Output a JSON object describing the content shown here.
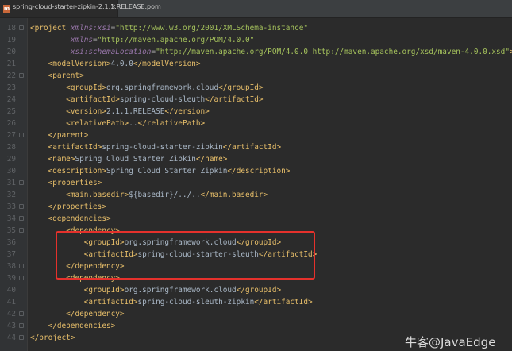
{
  "tab": {
    "icon_letter": "m",
    "title": "spring-cloud-starter-zipkin-2.1.1.RELEASE.pom",
    "close": "×"
  },
  "lines": [
    {
      "num": "18",
      "fold": true,
      "tokens": [
        {
          "c": "b",
          "t": "<"
        },
        {
          "c": "tg",
          "t": "project "
        },
        {
          "c": "ns",
          "t": "xmlns:xsi"
        },
        {
          "c": "at",
          "t": "="
        },
        {
          "c": "av",
          "t": "\"http://www.w3.org/2001/XMLSchema-instance\""
        }
      ]
    },
    {
      "num": "19",
      "fold": false,
      "tokens": [
        {
          "c": "tx",
          "t": "         "
        },
        {
          "c": "ns",
          "t": "xmlns"
        },
        {
          "c": "at",
          "t": "="
        },
        {
          "c": "av",
          "t": "\"http://maven.apache.org/POM/4.0.0\""
        }
      ]
    },
    {
      "num": "20",
      "fold": false,
      "tokens": [
        {
          "c": "tx",
          "t": "         "
        },
        {
          "c": "ns",
          "t": "xsi:schemaLocation"
        },
        {
          "c": "at",
          "t": "="
        },
        {
          "c": "av",
          "t": "\"http://maven.apache.org/POM/4.0.0 http://maven.apache.org/xsd/maven-4.0.0.xsd\""
        },
        {
          "c": "b",
          "t": ">"
        }
      ]
    },
    {
      "num": "21",
      "fold": false,
      "tokens": [
        {
          "c": "tx",
          "t": "    "
        },
        {
          "c": "b",
          "t": "<"
        },
        {
          "c": "tg",
          "t": "modelVersion"
        },
        {
          "c": "b",
          "t": ">"
        },
        {
          "c": "tx",
          "t": "4.0.0"
        },
        {
          "c": "b",
          "t": "</"
        },
        {
          "c": "tg",
          "t": "modelVersion"
        },
        {
          "c": "b",
          "t": ">"
        }
      ]
    },
    {
      "num": "22",
      "fold": true,
      "tokens": [
        {
          "c": "tx",
          "t": "    "
        },
        {
          "c": "b",
          "t": "<"
        },
        {
          "c": "tg",
          "t": "parent"
        },
        {
          "c": "b",
          "t": ">"
        }
      ]
    },
    {
      "num": "23",
      "fold": false,
      "tokens": [
        {
          "c": "tx",
          "t": "        "
        },
        {
          "c": "b",
          "t": "<"
        },
        {
          "c": "tg",
          "t": "groupId"
        },
        {
          "c": "b",
          "t": ">"
        },
        {
          "c": "tx",
          "t": "org.springframework.cloud"
        },
        {
          "c": "b",
          "t": "</"
        },
        {
          "c": "tg",
          "t": "groupId"
        },
        {
          "c": "b",
          "t": ">"
        }
      ]
    },
    {
      "num": "24",
      "fold": false,
      "tokens": [
        {
          "c": "tx",
          "t": "        "
        },
        {
          "c": "b",
          "t": "<"
        },
        {
          "c": "tg",
          "t": "artifactId"
        },
        {
          "c": "b",
          "t": ">"
        },
        {
          "c": "tx",
          "t": "spring-cloud-sleuth"
        },
        {
          "c": "b",
          "t": "</"
        },
        {
          "c": "tg",
          "t": "artifactId"
        },
        {
          "c": "b",
          "t": ">"
        }
      ]
    },
    {
      "num": "25",
      "fold": false,
      "tokens": [
        {
          "c": "tx",
          "t": "        "
        },
        {
          "c": "b",
          "t": "<"
        },
        {
          "c": "tg",
          "t": "version"
        },
        {
          "c": "b",
          "t": ">"
        },
        {
          "c": "tx",
          "t": "2.1.1.RELEASE"
        },
        {
          "c": "b",
          "t": "</"
        },
        {
          "c": "tg",
          "t": "version"
        },
        {
          "c": "b",
          "t": ">"
        }
      ]
    },
    {
      "num": "26",
      "fold": false,
      "tokens": [
        {
          "c": "tx",
          "t": "        "
        },
        {
          "c": "b",
          "t": "<"
        },
        {
          "c": "tg",
          "t": "relativePath"
        },
        {
          "c": "b",
          "t": ">"
        },
        {
          "c": "tx",
          "t": ".."
        },
        {
          "c": "b",
          "t": "</"
        },
        {
          "c": "tg",
          "t": "relativePath"
        },
        {
          "c": "b",
          "t": ">"
        }
      ]
    },
    {
      "num": "27",
      "fold": true,
      "tokens": [
        {
          "c": "tx",
          "t": "    "
        },
        {
          "c": "b",
          "t": "</"
        },
        {
          "c": "tg",
          "t": "parent"
        },
        {
          "c": "b",
          "t": ">"
        }
      ]
    },
    {
      "num": "28",
      "fold": false,
      "tokens": [
        {
          "c": "tx",
          "t": "    "
        },
        {
          "c": "b",
          "t": "<"
        },
        {
          "c": "tg",
          "t": "artifactId"
        },
        {
          "c": "b",
          "t": ">"
        },
        {
          "c": "tx",
          "t": "spring-cloud-starter-zipkin"
        },
        {
          "c": "b",
          "t": "</"
        },
        {
          "c": "tg",
          "t": "artifactId"
        },
        {
          "c": "b",
          "t": ">"
        }
      ]
    },
    {
      "num": "29",
      "fold": false,
      "tokens": [
        {
          "c": "tx",
          "t": "    "
        },
        {
          "c": "b",
          "t": "<"
        },
        {
          "c": "tg",
          "t": "name"
        },
        {
          "c": "b",
          "t": ">"
        },
        {
          "c": "tx",
          "t": "Spring Cloud Starter Zipkin"
        },
        {
          "c": "b",
          "t": "</"
        },
        {
          "c": "tg",
          "t": "name"
        },
        {
          "c": "b",
          "t": ">"
        }
      ]
    },
    {
      "num": "30",
      "fold": false,
      "tokens": [
        {
          "c": "tx",
          "t": "    "
        },
        {
          "c": "b",
          "t": "<"
        },
        {
          "c": "tg",
          "t": "description"
        },
        {
          "c": "b",
          "t": ">"
        },
        {
          "c": "tx",
          "t": "Spring Cloud Starter Zipkin"
        },
        {
          "c": "b",
          "t": "</"
        },
        {
          "c": "tg",
          "t": "description"
        },
        {
          "c": "b",
          "t": ">"
        }
      ]
    },
    {
      "num": "31",
      "fold": true,
      "tokens": [
        {
          "c": "tx",
          "t": "    "
        },
        {
          "c": "b",
          "t": "<"
        },
        {
          "c": "tg",
          "t": "properties"
        },
        {
          "c": "b",
          "t": ">"
        }
      ]
    },
    {
      "num": "32",
      "fold": false,
      "tokens": [
        {
          "c": "tx",
          "t": "        "
        },
        {
          "c": "b",
          "t": "<"
        },
        {
          "c": "tg",
          "t": "main.basedir"
        },
        {
          "c": "b",
          "t": ">"
        },
        {
          "c": "tx",
          "t": "${basedir}/../.."
        },
        {
          "c": "b",
          "t": "</"
        },
        {
          "c": "tg",
          "t": "main.basedir"
        },
        {
          "c": "b",
          "t": ">"
        }
      ]
    },
    {
      "num": "33",
      "fold": true,
      "tokens": [
        {
          "c": "tx",
          "t": "    "
        },
        {
          "c": "b",
          "t": "</"
        },
        {
          "c": "tg",
          "t": "properties"
        },
        {
          "c": "b",
          "t": ">"
        }
      ]
    },
    {
      "num": "34",
      "fold": true,
      "tokens": [
        {
          "c": "tx",
          "t": "    "
        },
        {
          "c": "b",
          "t": "<"
        },
        {
          "c": "tg",
          "t": "dependencies"
        },
        {
          "c": "b",
          "t": ">"
        }
      ]
    },
    {
      "num": "35",
      "fold": true,
      "tokens": [
        {
          "c": "tx",
          "t": "        "
        },
        {
          "c": "b",
          "t": "<"
        },
        {
          "c": "tg",
          "t": "dependency"
        },
        {
          "c": "b",
          "t": ">"
        }
      ]
    },
    {
      "num": "36",
      "fold": false,
      "tokens": [
        {
          "c": "tx",
          "t": "            "
        },
        {
          "c": "b",
          "t": "<"
        },
        {
          "c": "tg",
          "t": "groupId"
        },
        {
          "c": "b",
          "t": ">"
        },
        {
          "c": "tx",
          "t": "org.springframework.cloud"
        },
        {
          "c": "b",
          "t": "</"
        },
        {
          "c": "tg",
          "t": "groupId"
        },
        {
          "c": "b",
          "t": ">"
        }
      ]
    },
    {
      "num": "37",
      "fold": false,
      "tokens": [
        {
          "c": "tx",
          "t": "            "
        },
        {
          "c": "b",
          "t": "<"
        },
        {
          "c": "tg",
          "t": "artifactId"
        },
        {
          "c": "b",
          "t": ">"
        },
        {
          "c": "tx",
          "t": "spring-cloud-starter-sleuth"
        },
        {
          "c": "b",
          "t": "</"
        },
        {
          "c": "tg",
          "t": "artifactId"
        },
        {
          "c": "b",
          "t": ">"
        }
      ]
    },
    {
      "num": "38",
      "fold": true,
      "tokens": [
        {
          "c": "tx",
          "t": "        "
        },
        {
          "c": "b",
          "t": "</"
        },
        {
          "c": "tg",
          "t": "dependency"
        },
        {
          "c": "b",
          "t": ">"
        }
      ]
    },
    {
      "num": "39",
      "fold": true,
      "tokens": [
        {
          "c": "tx",
          "t": "        "
        },
        {
          "c": "b",
          "t": "<"
        },
        {
          "c": "tg",
          "t": "dependency"
        },
        {
          "c": "b",
          "t": ">"
        }
      ]
    },
    {
      "num": "40",
      "fold": false,
      "tokens": [
        {
          "c": "tx",
          "t": "            "
        },
        {
          "c": "b",
          "t": "<"
        },
        {
          "c": "tg",
          "t": "groupId"
        },
        {
          "c": "b",
          "t": ">"
        },
        {
          "c": "tx",
          "t": "org.springframework.cloud"
        },
        {
          "c": "b",
          "t": "</"
        },
        {
          "c": "tg",
          "t": "groupId"
        },
        {
          "c": "b",
          "t": ">"
        }
      ]
    },
    {
      "num": "41",
      "fold": false,
      "tokens": [
        {
          "c": "tx",
          "t": "            "
        },
        {
          "c": "b",
          "t": "<"
        },
        {
          "c": "tg",
          "t": "artifactId"
        },
        {
          "c": "b",
          "t": ">"
        },
        {
          "c": "tx",
          "t": "spring-cloud-sleuth-zipkin"
        },
        {
          "c": "b",
          "t": "</"
        },
        {
          "c": "tg",
          "t": "artifactId"
        },
        {
          "c": "b",
          "t": ">"
        }
      ]
    },
    {
      "num": "42",
      "fold": true,
      "tokens": [
        {
          "c": "tx",
          "t": "        "
        },
        {
          "c": "b",
          "t": "</"
        },
        {
          "c": "tg",
          "t": "dependency"
        },
        {
          "c": "b",
          "t": ">"
        }
      ]
    },
    {
      "num": "43",
      "fold": true,
      "tokens": [
        {
          "c": "tx",
          "t": "    "
        },
        {
          "c": "b",
          "t": "</"
        },
        {
          "c": "tg",
          "t": "dependencies"
        },
        {
          "c": "b",
          "t": ">"
        }
      ]
    },
    {
      "num": "44",
      "fold": true,
      "tokens": [
        {
          "c": "b",
          "t": "</"
        },
        {
          "c": "tg",
          "t": "project"
        },
        {
          "c": "b",
          "t": ">"
        }
      ]
    }
  ],
  "watermark": "牛客@JavaEdge",
  "colors": {
    "background": "#2b2b2b",
    "gutter": "#313335",
    "tag": "#e8bf6a",
    "text": "#a9b7c6",
    "namespace_attr": "#9876aa",
    "attr_value": "#a5c25c",
    "highlight_box": "#e5312c"
  }
}
